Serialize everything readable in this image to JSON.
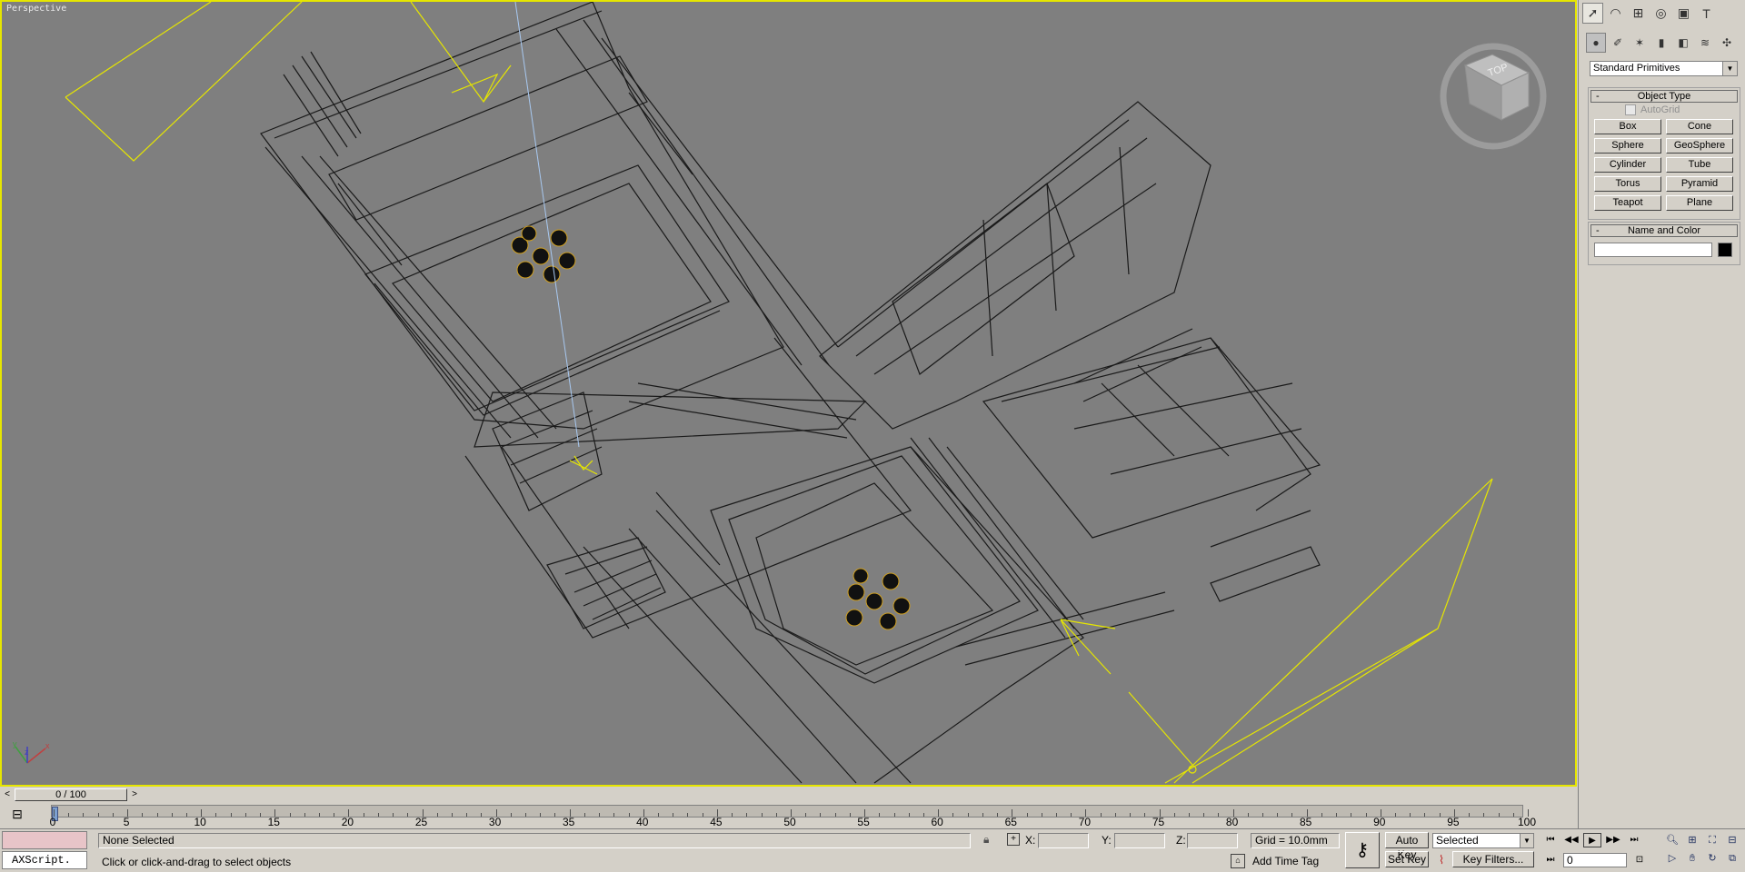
{
  "viewport": {
    "label": "Perspective",
    "viewcube_label": "TOP",
    "axis_labels": [
      "x",
      "y",
      "z"
    ]
  },
  "command_panel": {
    "tabs": [
      {
        "icon": "arrow-cursor-icon",
        "glyph": "➚",
        "active": true
      },
      {
        "icon": "modify-icon",
        "glyph": "◠"
      },
      {
        "icon": "hierarchy-icon",
        "glyph": "⊞"
      },
      {
        "icon": "motion-icon",
        "glyph": "◎"
      },
      {
        "icon": "display-icon",
        "glyph": "▣"
      },
      {
        "icon": "utilities-icon",
        "glyph": "T"
      }
    ],
    "subtabs": [
      {
        "icon": "geometry-icon",
        "glyph": "●",
        "active": true
      },
      {
        "icon": "shapes-icon",
        "glyph": "✐"
      },
      {
        "icon": "lights-icon",
        "glyph": "✶"
      },
      {
        "icon": "cameras-icon",
        "glyph": "▮"
      },
      {
        "icon": "helpers-icon",
        "glyph": "◧"
      },
      {
        "icon": "spacewarps-icon",
        "glyph": "≋"
      },
      {
        "icon": "systems-icon",
        "glyph": "✣"
      }
    ],
    "category": "Standard Primitives",
    "object_type": {
      "title": "Object Type",
      "collapse": "-",
      "autogrid": "AutoGrid",
      "buttons": [
        "Box",
        "Cone",
        "Sphere",
        "GeoSphere",
        "Cylinder",
        "Tube",
        "Torus",
        "Pyramid",
        "Teapot",
        "Plane"
      ]
    },
    "name_color": {
      "title": "Name and Color",
      "collapse": "-",
      "name_value": "",
      "color": "#000000"
    }
  },
  "time_slider": {
    "label": "0 / 100",
    "prev": "<",
    "next": ">"
  },
  "ruler": {
    "labels": [
      "0",
      "5",
      "10",
      "15",
      "20",
      "25",
      "30",
      "35",
      "40",
      "45",
      "50",
      "55",
      "60",
      "65",
      "70",
      "75",
      "80",
      "85",
      "90",
      "95",
      "100"
    ]
  },
  "status": {
    "maxscript_output": "AXScript.",
    "selection": "None Selected",
    "prompt": "Click or click-and-drag to select objects",
    "x_label": "X:",
    "y_label": "Y:",
    "z_label": "Z:",
    "x_value": "",
    "y_value": "",
    "z_value": "",
    "grid": "Grid = 10.0mm",
    "add_time_tag": "Add Time Tag",
    "auto_key": "Auto Key",
    "set_key": "Set Key",
    "key_mode": "Selected",
    "key_filters": "Key Filters...",
    "current_frame": "0"
  }
}
